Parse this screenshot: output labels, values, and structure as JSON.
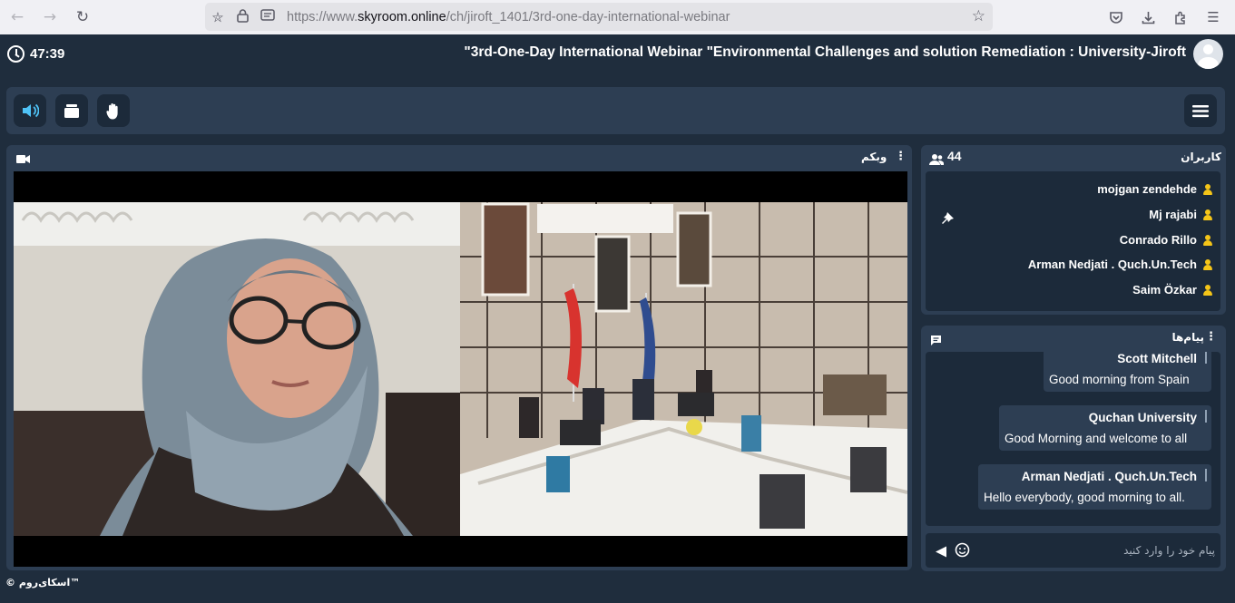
{
  "browser": {
    "url_prefix": "https://www.",
    "url_host": "skyroom.online",
    "url_path": "/ch/jiroft_1401/3rd-one-day-international-webinar"
  },
  "header": {
    "timer": "47:39",
    "title": "\"3rd-One-Day International Webinar \"Environmental Challenges and solution Remediation : University-Jiroft"
  },
  "toolbar": {
    "icons": [
      "speaker-icon",
      "camera-roll-icon",
      "raise-hand-icon",
      "menu-icon"
    ]
  },
  "webcam": {
    "title": "وبکم",
    "feeds": [
      {
        "description_label": "presenter"
      },
      {
        "description_label": "conference-room"
      }
    ]
  },
  "users": {
    "title": "کاربران",
    "count": "44",
    "list": [
      "mojgan zendehde",
      "Mj rajabi",
      "Conrado Rillo",
      "Arman Nedjati . Quch.Un.Tech",
      "Saim Özkar"
    ]
  },
  "messages": {
    "title": "پیام‌ها",
    "items": [
      {
        "sender": "Scott Mitchell",
        "text": "Good morning from Spain"
      },
      {
        "sender": "Quchan University",
        "text": "Good Morning and welcome to all"
      },
      {
        "sender": "Arman Nedjati . Quch.Un.Tech",
        "text": "Hello everybody, good morning to all."
      }
    ],
    "placeholder": "پیام خود را وارد کنید"
  },
  "footer": {
    "text": "© اسکای‌روم™"
  },
  "colors": {
    "background": "#1f2d3d",
    "panel": "#2d3e53",
    "panel_inner": "#1c2a3a",
    "accent": "#4fc3f7",
    "user_icon": "#f5c518"
  }
}
